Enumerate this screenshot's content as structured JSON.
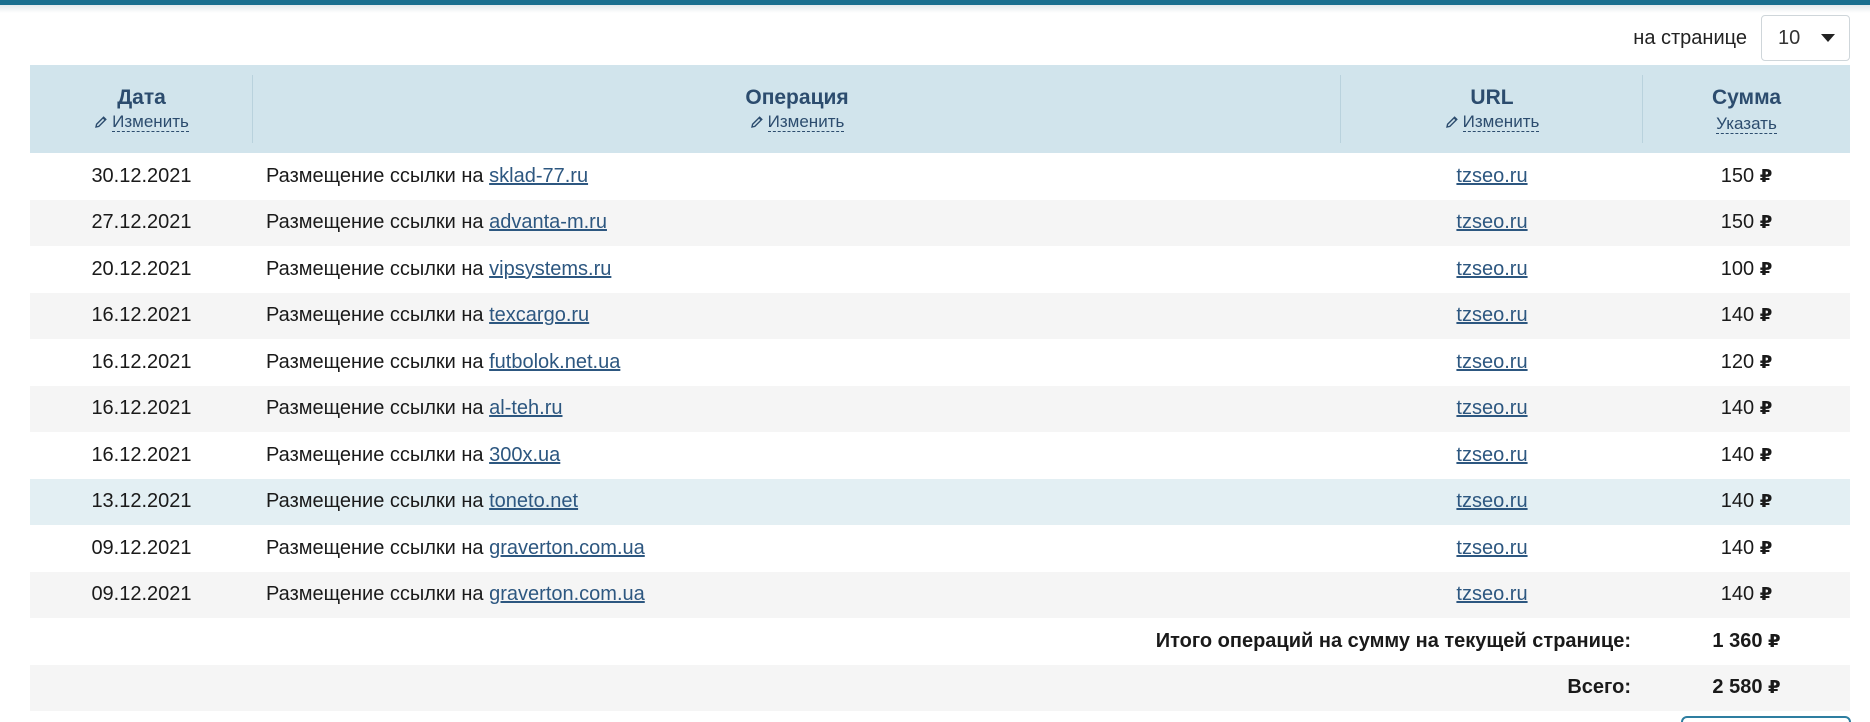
{
  "pagination": {
    "per_page_label": "на странице",
    "per_page_value": "10"
  },
  "columns": {
    "date": {
      "title": "Дата",
      "action": "Изменить"
    },
    "operation": {
      "title": "Операция",
      "action": "Изменить"
    },
    "url": {
      "title": "URL",
      "action": "Изменить"
    },
    "sum": {
      "title": "Сумма",
      "action": "Указать"
    }
  },
  "currency": "₽",
  "rows": [
    {
      "date": "30.12.2021",
      "op_prefix": "Размещение ссылки на",
      "site": "sklad-77.ru",
      "url": "tzseo.ru",
      "amount": "150"
    },
    {
      "date": "27.12.2021",
      "op_prefix": "Размещение ссылки на",
      "site": "advanta-m.ru",
      "url": "tzseo.ru",
      "amount": "150"
    },
    {
      "date": "20.12.2021",
      "op_prefix": "Размещение ссылки на",
      "site": "vipsystems.ru",
      "url": "tzseo.ru",
      "amount": "100"
    },
    {
      "date": "16.12.2021",
      "op_prefix": "Размещение ссылки на",
      "site": "texcargo.ru",
      "url": "tzseo.ru",
      "amount": "140"
    },
    {
      "date": "16.12.2021",
      "op_prefix": "Размещение ссылки на",
      "site": "futbolok.net.ua",
      "url": "tzseo.ru",
      "amount": "120"
    },
    {
      "date": "16.12.2021",
      "op_prefix": "Размещение ссылки на",
      "site": "al-teh.ru",
      "url": "tzseo.ru",
      "amount": "140"
    },
    {
      "date": "16.12.2021",
      "op_prefix": "Размещение ссылки на",
      "site": "300x.ua",
      "url": "tzseo.ru",
      "amount": "140"
    },
    {
      "date": "13.12.2021",
      "op_prefix": "Размещение ссылки на",
      "site": "toneto.net",
      "url": "tzseo.ru",
      "amount": "140"
    },
    {
      "date": "09.12.2021",
      "op_prefix": "Размещение ссылки на",
      "site": "graverton.com.ua",
      "url": "tzseo.ru",
      "amount": "140"
    },
    {
      "date": "09.12.2021",
      "op_prefix": "Размещение ссылки на",
      "site": "graverton.com.ua",
      "url": "tzseo.ru",
      "amount": "140"
    }
  ],
  "totals": {
    "page_label": "Итого операций на сумму на текущей странице:",
    "page_value": "1 360",
    "all_label": "Всего:",
    "all_value": "2 580"
  },
  "colors": {
    "accent": "#1b6f8f",
    "header_bg": "#d1e4ec",
    "link": "#2d5780",
    "highlight_row": "#e3eff3"
  }
}
